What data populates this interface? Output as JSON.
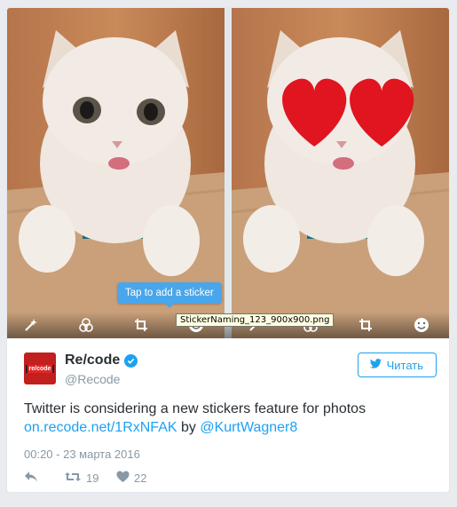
{
  "media": {
    "tooltip": "Tap to add a sticker",
    "filename_tooltip": "StickerNaming_123_900x900.png",
    "left_tools": [
      "magic-wand-icon",
      "filters-icon",
      "crop-icon",
      "sticker-icon"
    ],
    "right_tools": [
      "magic-wand-icon",
      "filters-icon",
      "crop-icon",
      "sticker-icon"
    ]
  },
  "author": {
    "avatar_text": "re/code",
    "name": "Re/code",
    "handle": "@Recode",
    "verified": true
  },
  "follow_button": {
    "label": "Читать",
    "icon": "twitter-bird-icon"
  },
  "tweet": {
    "text": "Twitter is considering a new stickers feature for photos",
    "link": "on.recode.net/1RxNFAK",
    "by": "by",
    "mention": "@KurtWagner8",
    "timestamp": "00:20 - 23 марта 2016"
  },
  "actions": {
    "reply": {
      "icon": "reply-icon"
    },
    "retweet": {
      "icon": "retweet-icon",
      "count": "19"
    },
    "like": {
      "icon": "heart-icon",
      "count": "22"
    }
  },
  "colors": {
    "accent": "#1da1f2",
    "muted": "#8899a6",
    "text": "#292f33",
    "tooltip": "#4aa6ea",
    "avatar": "#c21f1f"
  }
}
